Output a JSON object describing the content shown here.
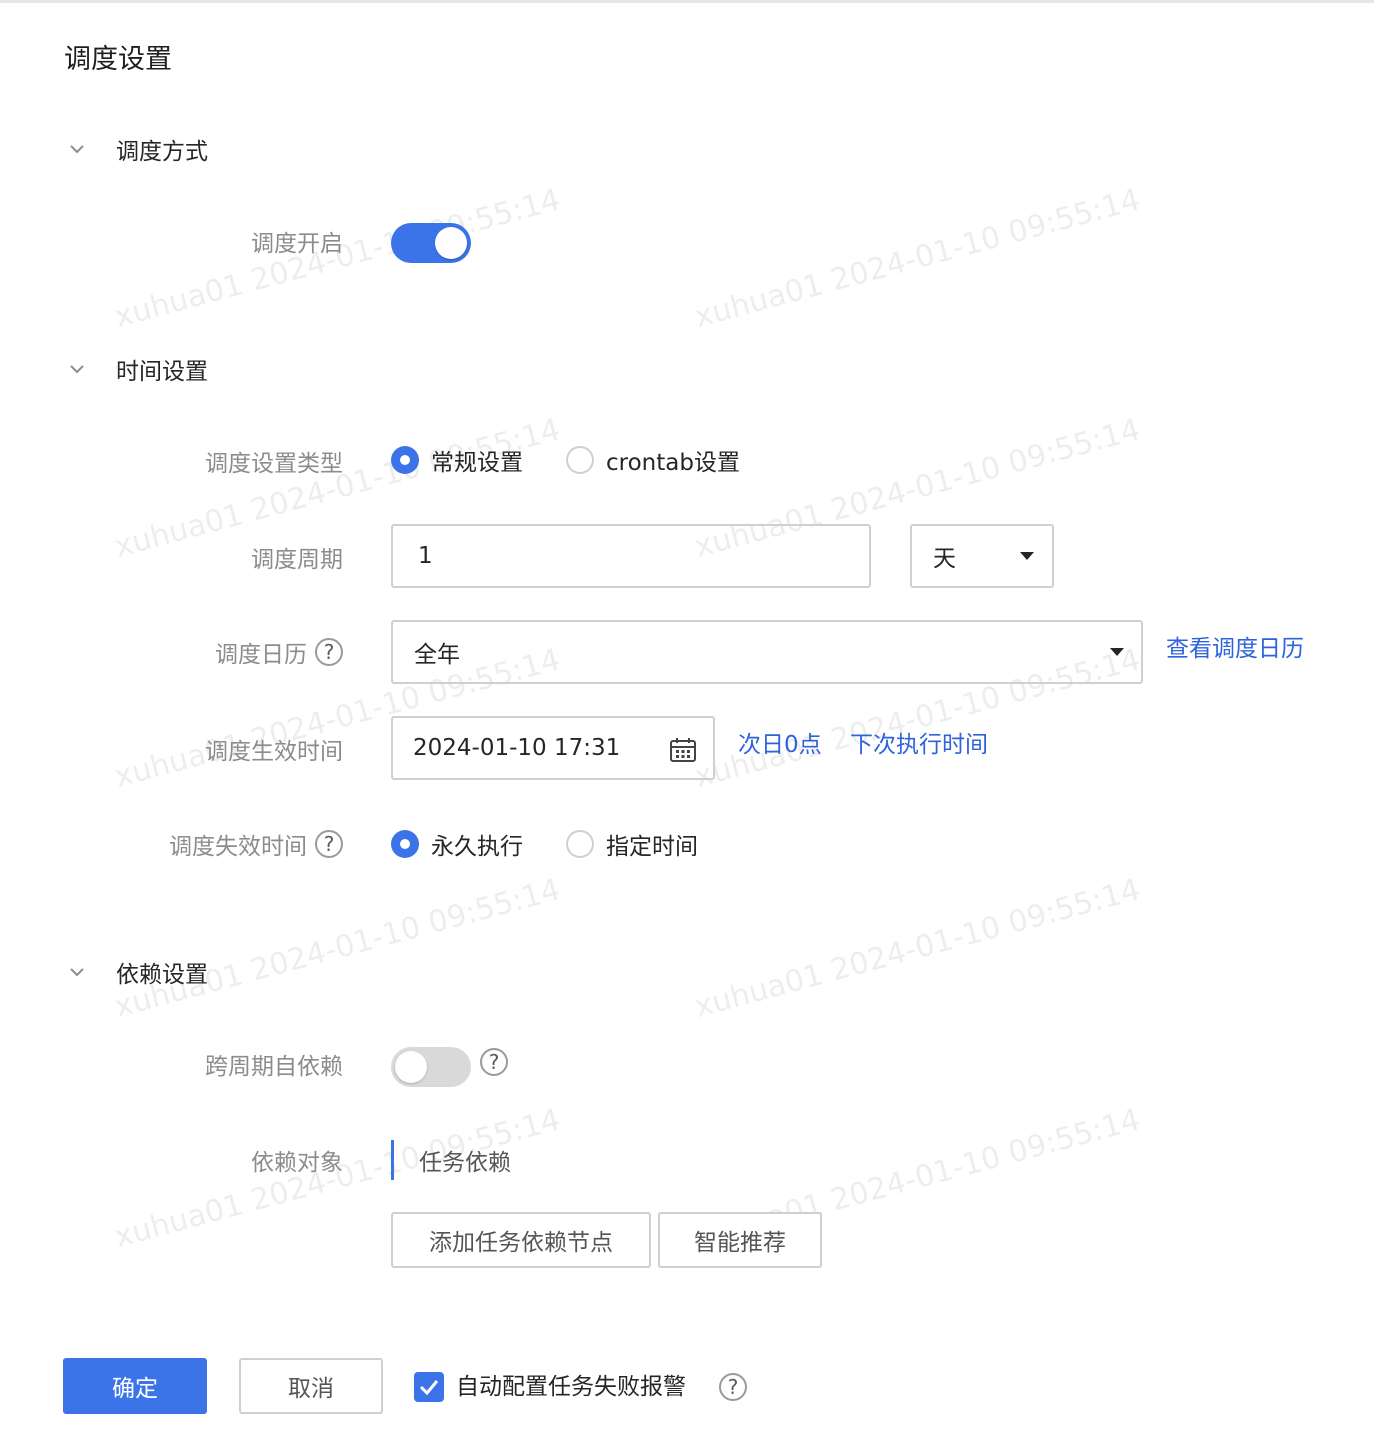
{
  "page_title": "调度设置",
  "sections": {
    "schedule_mode": {
      "title": "调度方式",
      "enable_label": "调度开启",
      "enable_on": true
    },
    "time": {
      "title": "时间设置",
      "type_label": "调度设置类型",
      "type_options": [
        "常规设置",
        "crontab设置"
      ],
      "type_selected": "常规设置",
      "period_label": "调度周期",
      "period_value": "1",
      "period_unit": "天",
      "calendar_label": "调度日历",
      "calendar_value": "全年",
      "calendar_link": "查看调度日历",
      "effective_label": "调度生效时间",
      "effective_value": "2024-01-10 17:31",
      "link_next_day": "次日0点",
      "link_next_run": "下次执行时间",
      "expire_label": "调度失效时间",
      "expire_options": [
        "永久执行",
        "指定时间"
      ],
      "expire_selected": "永久执行"
    },
    "dependency": {
      "title": "依赖设置",
      "self_dep_label": "跨周期自依赖",
      "self_dep_on": false,
      "object_label": "依赖对象",
      "object_tab": "任务依赖",
      "add_button": "添加任务依赖节点",
      "smart_button": "智能推荐"
    }
  },
  "footer": {
    "confirm": "确定",
    "cancel": "取消",
    "auto_alarm_label": "自动配置任务失败报警",
    "auto_alarm_checked": true
  },
  "watermark": "xuhua01 2024-01-10 09:55:14",
  "help_glyph": "?",
  "colors": {
    "primary": "#3b73e8",
    "link": "#2f63dd",
    "label": "#8c8c8c",
    "border": "#d0d0d0"
  }
}
